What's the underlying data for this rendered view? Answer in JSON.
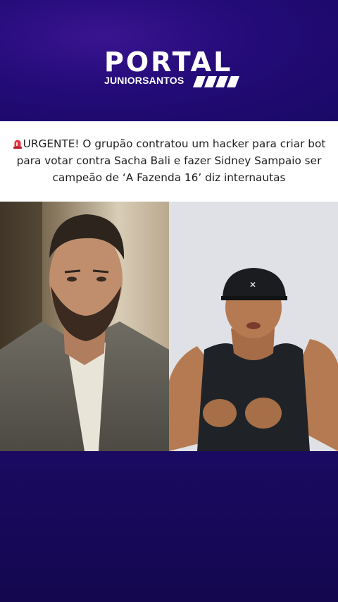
{
  "brand": {
    "title": "PORTAL",
    "subtitle": "JUNIORSANTOS"
  },
  "headline": {
    "icon": "siren-icon",
    "text": "URGENTE! O grupão contratou um hacker para criar bot para votar contra Sacha Bali e fazer Sidney Sampaio ser campeão de ‘A Fazenda 16’ diz internautas"
  },
  "photos": [
    {
      "subject": "bearded man in grey shirt"
    },
    {
      "subject": "man in black cap and tank top"
    }
  ],
  "colors": {
    "background": "#1a0a62",
    "header_accent": "#3a1490",
    "headline_bg": "#ffffff",
    "text": "#1f1f1f"
  }
}
